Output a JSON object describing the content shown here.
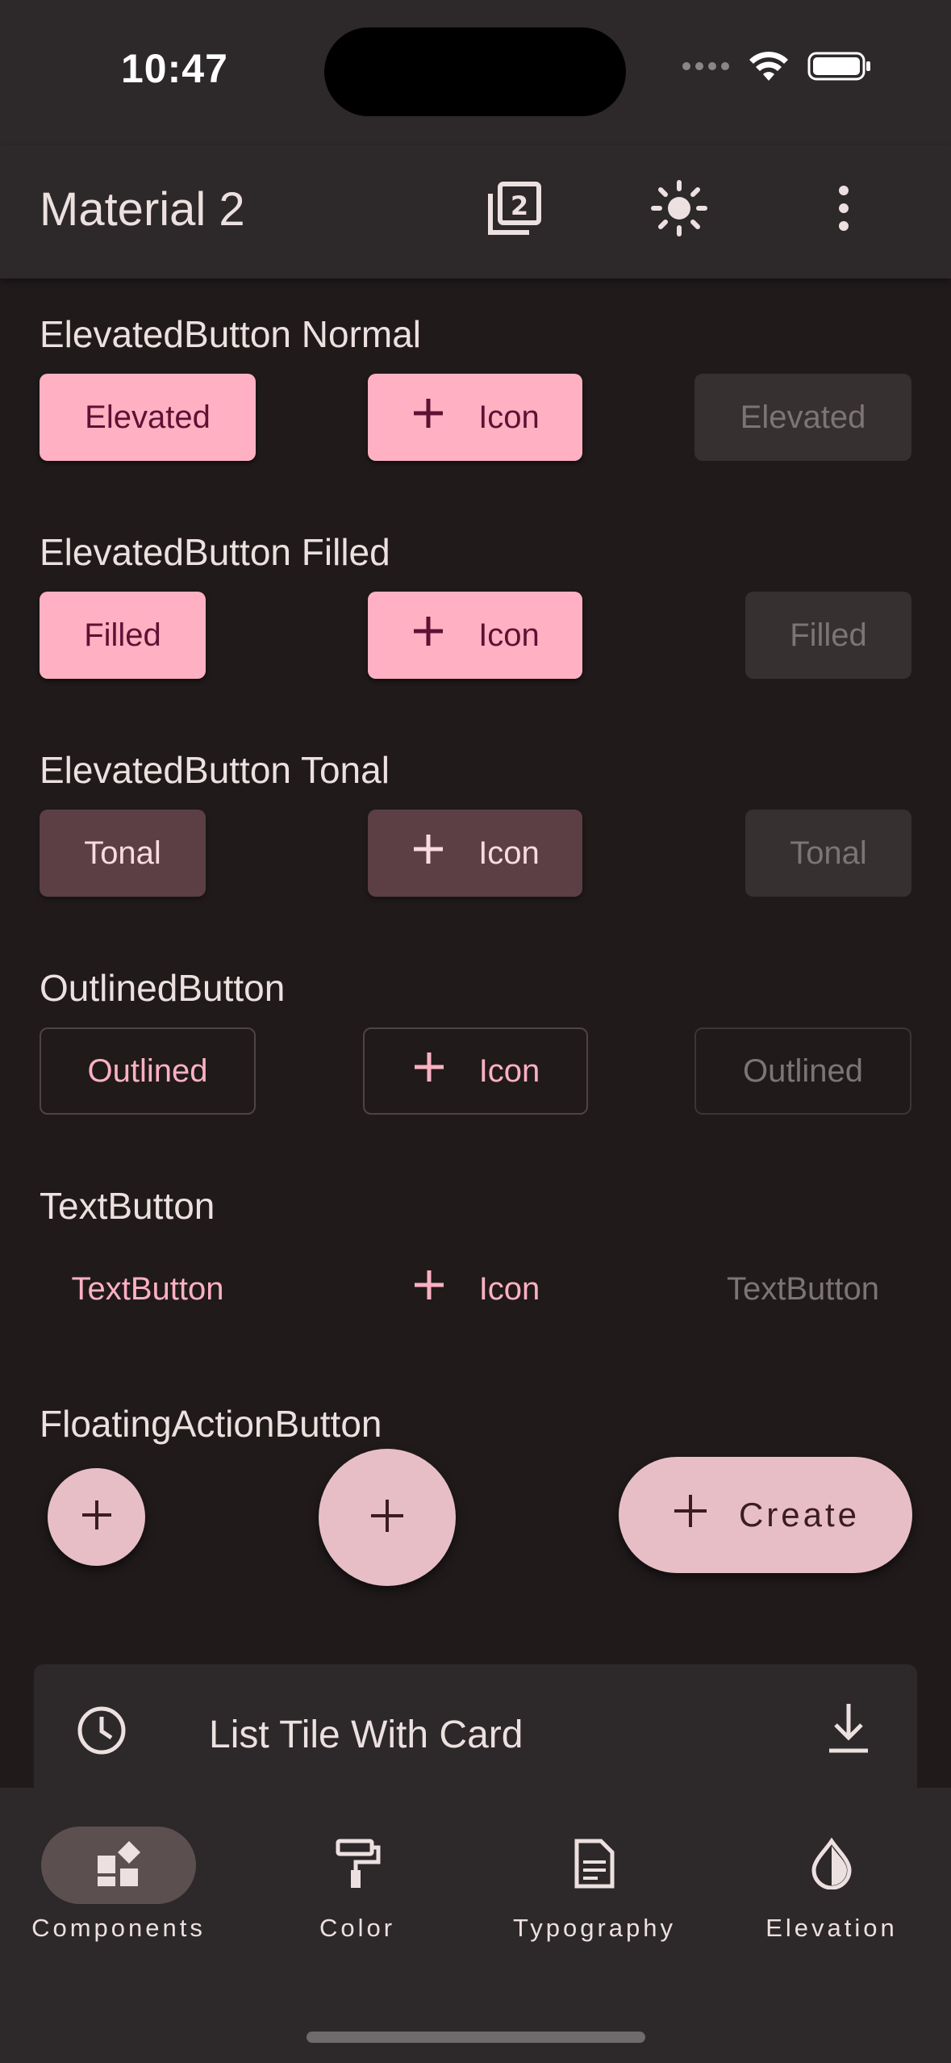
{
  "status_bar": {
    "time": "10:47"
  },
  "app_bar": {
    "title": "Material 2"
  },
  "sections": {
    "elevated_normal": {
      "title": "ElevatedButton Normal",
      "btn1": "Elevated",
      "btn2": "Icon",
      "btn3": "Elevated"
    },
    "elevated_filled": {
      "title": "ElevatedButton Filled",
      "btn1": "Filled",
      "btn2": "Icon",
      "btn3": "Filled"
    },
    "elevated_tonal": {
      "title": "ElevatedButton Tonal",
      "btn1": "Tonal",
      "btn2": "Icon",
      "btn3": "Tonal"
    },
    "outlined": {
      "title": "OutlinedButton",
      "btn1": "Outlined",
      "btn2": "Icon",
      "btn3": "Outlined"
    },
    "text": {
      "title": "TextButton",
      "btn1": "TextButton",
      "btn2": "Icon",
      "btn3": "TextButton"
    },
    "fab": {
      "title": "FloatingActionButton",
      "extended_label": "Create"
    }
  },
  "card": {
    "label": "List Tile With Card"
  },
  "nav": {
    "items": [
      {
        "label": "Components",
        "icon": "widgets-icon",
        "active": true
      },
      {
        "label": "Color",
        "icon": "paint-roller-icon",
        "active": false
      },
      {
        "label": "Typography",
        "icon": "article-icon",
        "active": false
      },
      {
        "label": "Elevation",
        "icon": "opacity-drop-icon",
        "active": false
      }
    ]
  },
  "colors": {
    "background": "#201a1b",
    "surface": "#2d2829",
    "primary": "#ffb1c3",
    "on_primary": "#5e1133",
    "tonal": "#5b3f45",
    "fab": "#e8bec6"
  }
}
